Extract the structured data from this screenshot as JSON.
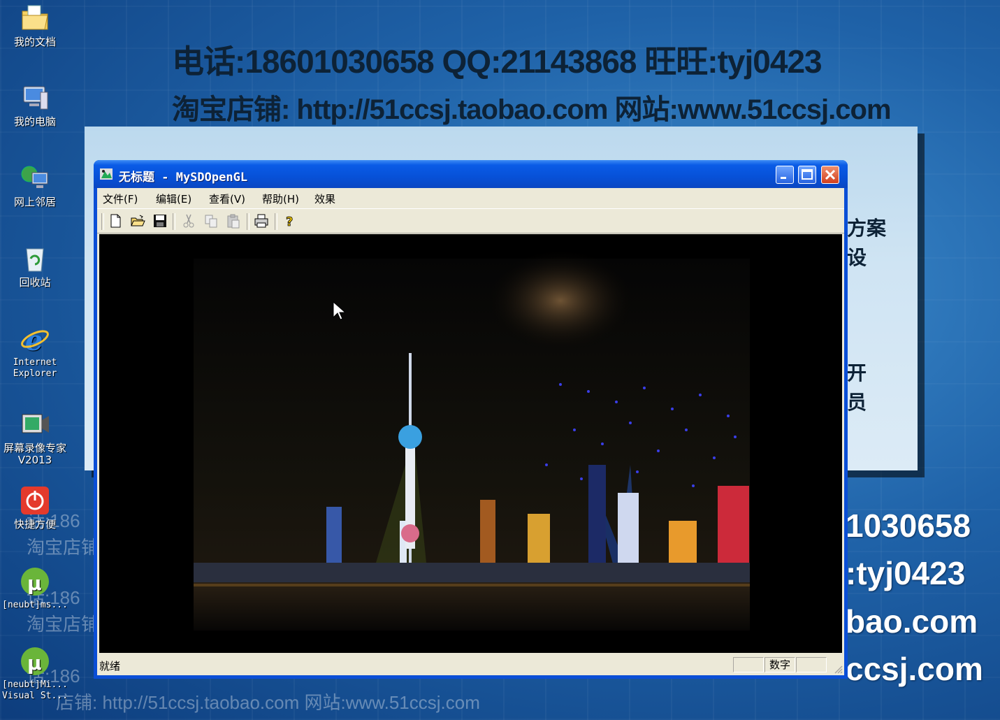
{
  "desktop": {
    "icons": [
      {
        "label": "我的文档",
        "icon": "folder-documents-icon"
      },
      {
        "label": "我的电脑",
        "icon": "computer-icon"
      },
      {
        "label": "网上邻居",
        "icon": "network-icon"
      },
      {
        "label": "回收站",
        "icon": "recycle-bin-icon"
      },
      {
        "label": "Internet Explorer",
        "icon": "ie-icon"
      },
      {
        "label": "屏幕录像专家 V2013",
        "icon": "screen-recorder-icon"
      },
      {
        "label": "快捷方便",
        "icon": "power-icon"
      },
      {
        "label": "[neubt]ms...",
        "icon": "utorrent-icon"
      },
      {
        "label": "[neubt]Mi... Visual St...",
        "icon": "utorrent-icon"
      }
    ],
    "banner_line1": "电话:18601030658    QQ:21143868    旺旺:tyj0423",
    "banner_line2": "淘宝店铺: http://51ccsj.taobao.com    网站:www.51ccsj.com",
    "panel_fragments": [
      "方案",
      "设",
      "开",
      "员"
    ],
    "bg_right": [
      "1030658",
      ":tyj0423",
      "bao.com",
      "ccsj.com"
    ],
    "bg_left_faint": [
      "话:186",
      "淘宝店铺:",
      "话:186",
      "淘宝店铺:",
      "话:186",
      "店铺: http://51ccsj.taobao.com    网站:www.51ccsj.com"
    ],
    "accent": "#0a4ed6"
  },
  "window": {
    "title": "无标题 - MySDOpenGL",
    "menu": [
      "文件(F)",
      "编辑(E)",
      "查看(V)",
      "帮助(H)",
      "效果"
    ],
    "toolbar": [
      "new-icon",
      "open-icon",
      "save-icon",
      "cut-icon",
      "copy-icon",
      "paste-icon",
      "print-icon",
      "help-icon"
    ],
    "status_left": "就绪",
    "status_num": "数字"
  }
}
